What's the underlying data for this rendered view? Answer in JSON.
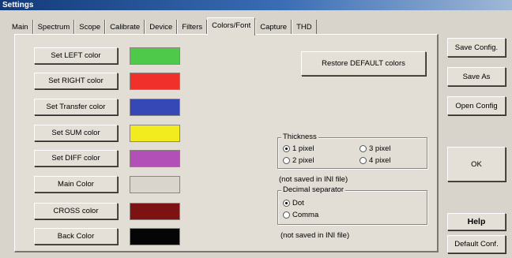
{
  "window": {
    "title": "Settings"
  },
  "tabs": [
    {
      "label": "Main"
    },
    {
      "label": "Spectrum"
    },
    {
      "label": "Scope"
    },
    {
      "label": "Calibrate"
    },
    {
      "label": "Device"
    },
    {
      "label": "Filters"
    },
    {
      "label": "Colors/Font"
    },
    {
      "label": "Capture"
    },
    {
      "label": "THD"
    }
  ],
  "active_tab": "Colors/Font",
  "color_rows": [
    {
      "label": "Set LEFT color",
      "color": "#4ec94a"
    },
    {
      "label": "Set RIGHT color",
      "color": "#f0302a"
    },
    {
      "label": "Set Transfer color",
      "color": "#3548b5"
    },
    {
      "label": "Set SUM color",
      "color": "#f2ec1e"
    },
    {
      "label": "Set DIFF color",
      "color": "#b250b8"
    },
    {
      "label": "Main Color",
      "color": "#d9d5cd"
    },
    {
      "label": "CROSS color",
      "color": "#7c1212"
    },
    {
      "label": "Back Color",
      "color": "#050505"
    }
  ],
  "restore_button": "Restore DEFAULT colors",
  "thickness": {
    "legend": "Thickness",
    "options": [
      {
        "label": "1 pixel",
        "selected": true
      },
      {
        "label": "3 pixel",
        "selected": false
      },
      {
        "label": "2 pixel",
        "selected": false
      },
      {
        "label": "4 pixel",
        "selected": false
      }
    ],
    "note": "(not saved in INI file)"
  },
  "decimal": {
    "legend": "Decimal separator",
    "options": [
      {
        "label": "Dot",
        "selected": true
      },
      {
        "label": "Comma",
        "selected": false
      }
    ],
    "note": "(not saved in INI file)"
  },
  "side_buttons": {
    "save_config": "Save Config.",
    "save_as": "Save As",
    "open_config": "Open Config",
    "ok": "OK",
    "help": "Help",
    "default_conf": "Default Conf."
  }
}
